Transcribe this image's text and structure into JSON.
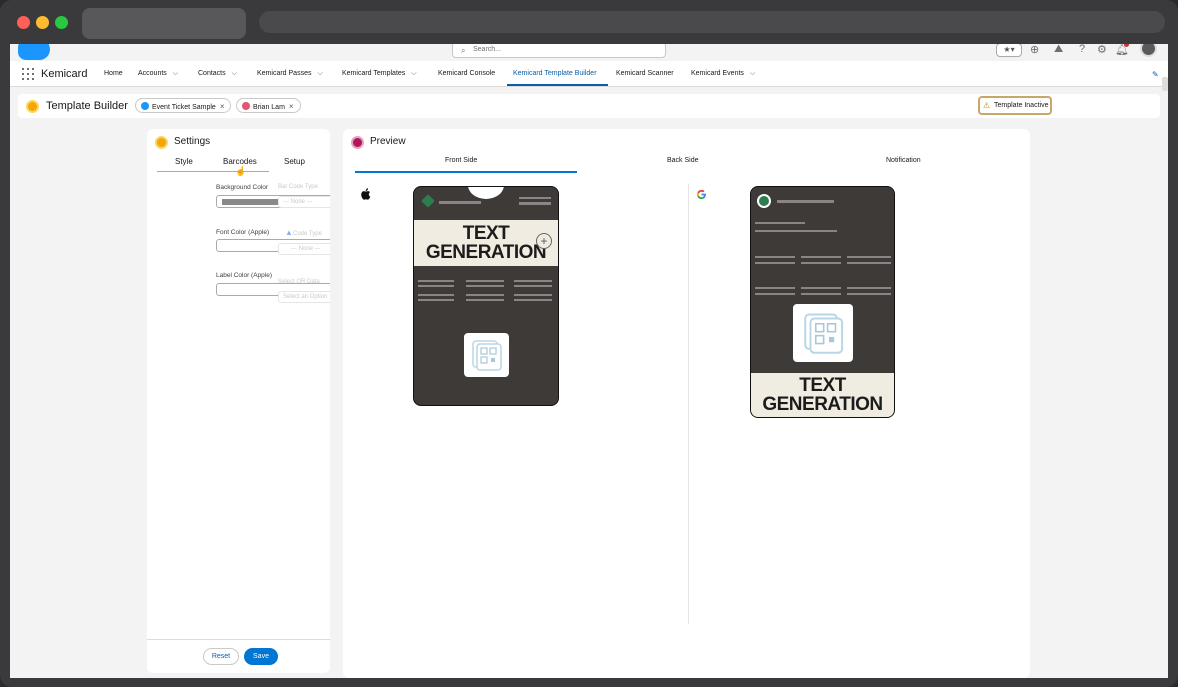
{
  "browser": {
    "dots": [
      "#fe5f57",
      "#febc2e",
      "#28c840"
    ]
  },
  "header": {
    "search_placeholder": "Search...",
    "app_name": "Kemicard",
    "utilities": [
      "star-icon",
      "add-icon",
      "trailhead-icon",
      "help-icon",
      "gear-icon",
      "bell-icon",
      "avatar"
    ]
  },
  "nav": {
    "items": [
      {
        "label": "Home",
        "chevron": false
      },
      {
        "label": "Accounts",
        "chevron": true
      },
      {
        "label": "Contacts",
        "chevron": true
      },
      {
        "label": "Kemicard Passes",
        "chevron": true
      },
      {
        "label": "Kemicard Templates",
        "chevron": true
      },
      {
        "label": "Kemicard Console",
        "chevron": false
      },
      {
        "label": "Kemicard Template Builder",
        "chevron": false,
        "active": true
      },
      {
        "label": "Kemicard Scanner",
        "chevron": false
      },
      {
        "label": "Kemicard Events",
        "chevron": true
      }
    ]
  },
  "toolbar": {
    "title": "Template Builder",
    "pills": [
      {
        "label": "Event Ticket Sample",
        "color": "#1b96ff"
      },
      {
        "label": "Brian Lam",
        "color": "#e3566e"
      }
    ],
    "status": "Template Inactive"
  },
  "settings": {
    "title": "Settings",
    "tabs": [
      "Style",
      "Barcodes",
      "Setup"
    ],
    "fields": {
      "background_color": "Background Color",
      "font_color": "Font Color (Apple)",
      "label_color": "Label Color (Apple)"
    },
    "ghost": {
      "bar_code_type": "Bar Code Type",
      "none1": "--- None ---",
      "code_type": "Code Type",
      "none2": "--- None ---",
      "select_qr": "Select QR Data",
      "select_option": "Select an Option"
    },
    "reset_label": "Reset",
    "save_label": "Save"
  },
  "preview": {
    "title": "Preview",
    "tabs": [
      "Front Side",
      "Back Side",
      "Notification"
    ],
    "apple_pass": {
      "line1": "TEXT",
      "line2": "GENERATION"
    },
    "google_pass": {
      "line1": "TEXT",
      "line2": "GENERATION"
    }
  }
}
